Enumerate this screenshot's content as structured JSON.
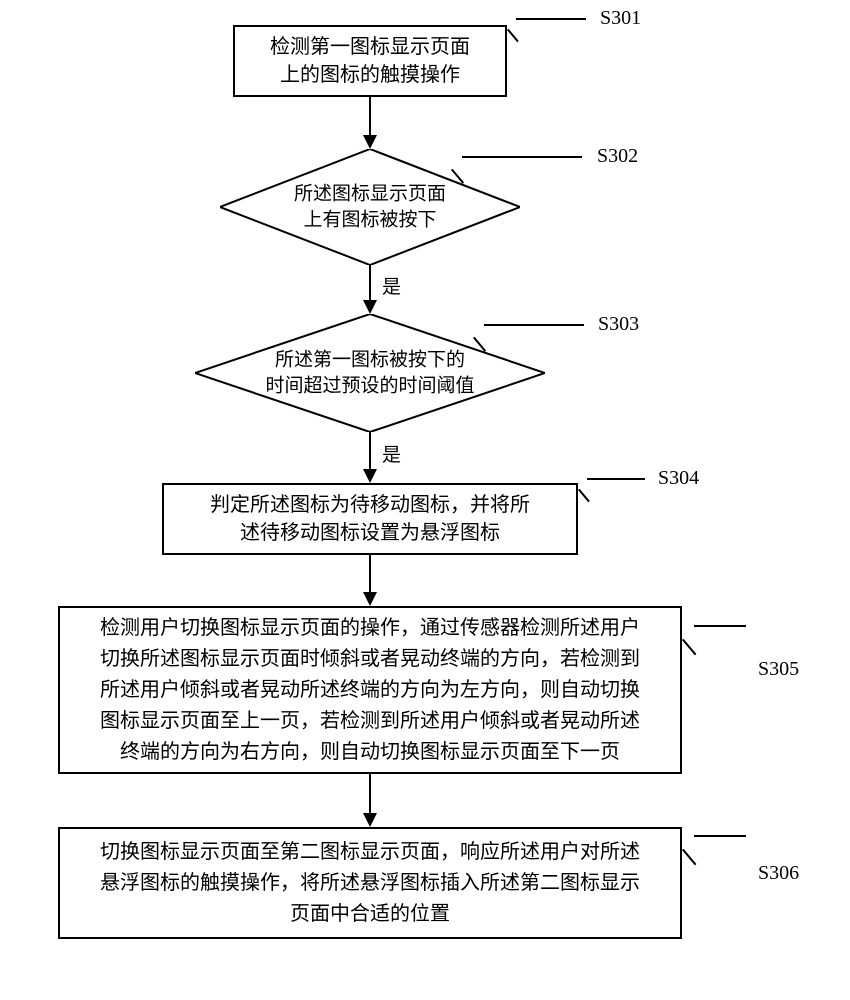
{
  "steps": {
    "s301": {
      "label": "S301",
      "text": "检测第一图标显示页面\n上的图标的触摸操作"
    },
    "s302": {
      "label": "S302",
      "text": "所述图标显示页面\n上有图标被按下"
    },
    "s303": {
      "label": "S303",
      "text": "所述第一图标被按下的\n时间超过预设的时间阈值"
    },
    "s304": {
      "label": "S304",
      "text": "判定所述图标为待移动图标，并将所\n述待移动图标设置为悬浮图标"
    },
    "s305": {
      "label": "S305",
      "text": "检测用户切换图标显示页面的操作，通过传感器检测所述用户\n切换所述图标显示页面时倾斜或者晃动终端的方向，若检测到\n所述用户倾斜或者晃动所述终端的方向为左方向，则自动切换\n图标显示页面至上一页，若检测到所述用户倾斜或者晃动所述\n终端的方向为右方向，则自动切换图标显示页面至下一页"
    },
    "s306": {
      "label": "S306",
      "text": "切换图标显示页面至第二图标显示页面，响应所述用户对所述\n悬浮图标的触摸操作，将所述悬浮图标插入所述第二图标显示\n页面中合适的位置"
    }
  },
  "edges": {
    "yes1": "是",
    "yes2": "是"
  }
}
